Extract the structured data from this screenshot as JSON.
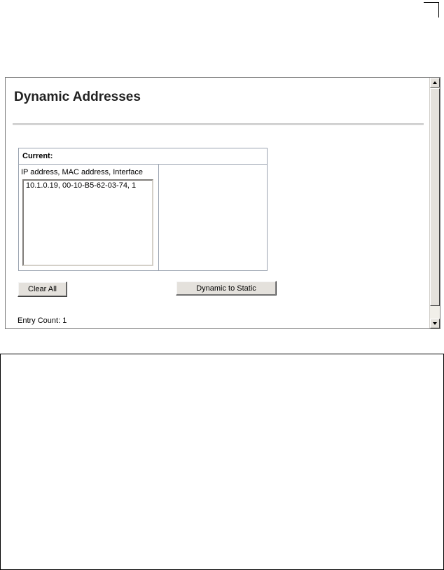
{
  "page": {
    "title": "Dynamic Addresses"
  },
  "current_panel": {
    "header": "Current:",
    "column_label": "IP address, MAC address, Interface",
    "entries": [
      "10.1.0.19, 00-10-B5-62-03-74, 1"
    ],
    "dynamic_to_static_label": "Dynamic to Static"
  },
  "clear_all_label": "Clear All",
  "entry_count": {
    "label": "Entry Count:",
    "value": "1"
  },
  "icons": {
    "scroll_up": "arrow-up-icon",
    "scroll_down": "arrow-down-icon"
  }
}
